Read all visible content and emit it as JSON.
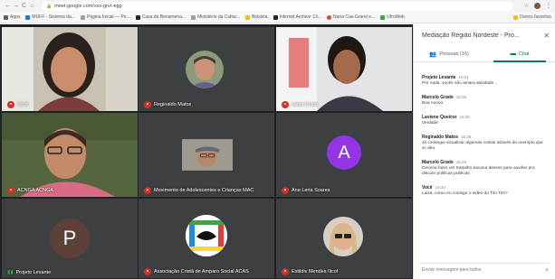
{
  "browser": {
    "nav": {
      "back": "←",
      "forward": "→",
      "reload": "C",
      "home": "⌂"
    },
    "url": "meet.google.com/xsv-grvr-egg",
    "bookmarks": [
      {
        "label": "Apps",
        "color": "#5f6368"
      },
      {
        "label": "MUFF - Sistema da...",
        "color": "#1a73e8"
      },
      {
        "label": "Página Inicial — Po...",
        "color": "#9aa0a6"
      },
      {
        "label": "Casa de Benamena...",
        "color": "#202124"
      },
      {
        "label": "Ministério da Cultur...",
        "color": "#9aa0a6"
      },
      {
        "label": "Bolsista",
        "color": "#fbbc04"
      },
      {
        "label": "Internet Archive: Di...",
        "color": "#202124"
      },
      {
        "label": "Nana Caa Grand e...",
        "color": "#ea4335"
      },
      {
        "label": "UfroWeb",
        "color": "#34a853"
      }
    ],
    "bookmarks_right": "Outros favoritos"
  },
  "tiles": [
    {
      "name": "Você"
    },
    {
      "name": "Reginaldo Matos"
    },
    {
      "name": "Laisa Costa"
    },
    {
      "name": "ACNGA ACNGA"
    },
    {
      "name": "Movimento de Adolescentes e Crianças MAC"
    },
    {
      "name": "Ana Leria Soares",
      "initial": "A"
    },
    {
      "name": "Projeto Levante",
      "initial": "P"
    },
    {
      "name": "Associação Cristã de Amparo Social ACAS"
    },
    {
      "name": "Estildiv Mendes Ilicol"
    }
  ],
  "panel": {
    "title": "Mediação Região Nordeste - Pro...",
    "tabs": {
      "people": "Pessoas (16)",
      "chat": "Chat"
    },
    "messages": [
      {
        "sender": "Projeto Levante",
        "time": "16:01",
        "text": "Por nada, vocês são amara atividade..."
      },
      {
        "sender": "Marcelo Grade",
        "time": "16:05",
        "text": "Boa noooo"
      },
      {
        "sender": "Laviene Queiroz",
        "time": "16:20",
        "text": "Verdade"
      },
      {
        "sender": "Reginaldo Matos",
        "time": "16:26",
        "text": "Já consegui visualizar algumas coisas através do exemplo que vc deu"
      },
      {
        "sender": "Marcelo Grade",
        "time": "16:29",
        "text": "Deveria fazer um trabalho bacana desses para auxiliar pra discutir politicas publicas"
      },
      {
        "sender": "Você",
        "time": "16:33",
        "text": "Laisa, como eu consigo o video do Tim Tim?"
      }
    ],
    "composer_placeholder": "Enviar mensagem para todos"
  }
}
